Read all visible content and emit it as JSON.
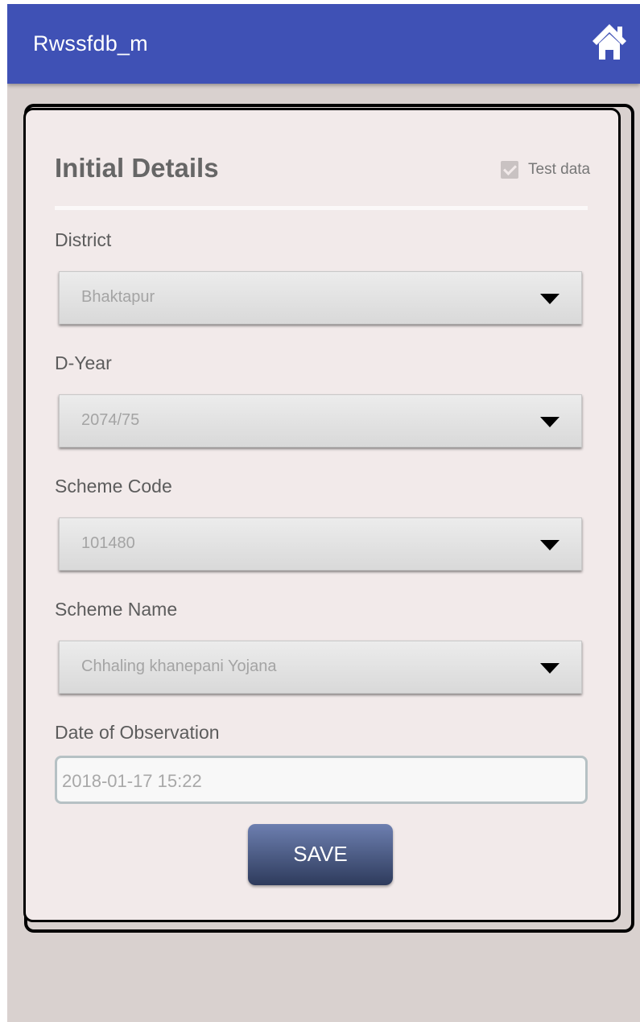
{
  "app": {
    "title": "Rwssfdb_m",
    "home_icon": "home-icon"
  },
  "form": {
    "title": "Initial Details",
    "test_data": {
      "label": "Test data",
      "checked": true
    },
    "district": {
      "label": "District",
      "value": "Bhaktapur"
    },
    "d_year": {
      "label": "D-Year",
      "value": "2074/75"
    },
    "scheme_code": {
      "label": "Scheme Code",
      "value": "101480"
    },
    "scheme_name": {
      "label": "Scheme Name",
      "value": "Chhaling khanepani Yojana"
    },
    "date_of_observation": {
      "label": "Date of Observation",
      "value": "2018-01-17 15:22"
    },
    "save_label": "SAVE"
  },
  "colors": {
    "appbar": "#3f51b5",
    "background": "#d9d1cf",
    "card": "#f2eaea"
  }
}
